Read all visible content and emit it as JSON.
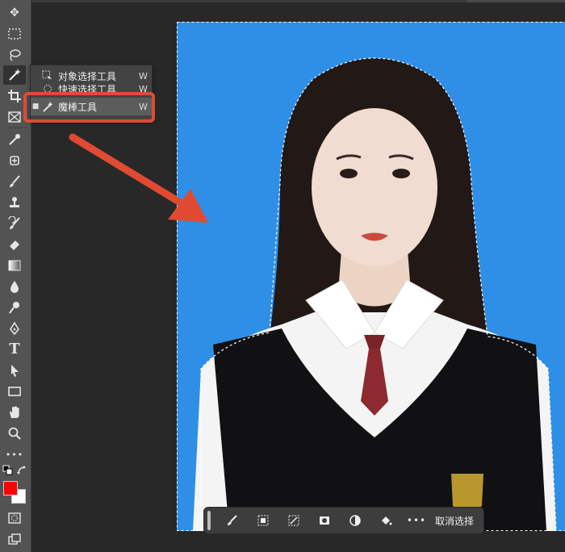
{
  "toolbar": {
    "tools": [
      {
        "name": "move-tool-icon",
        "glyph": "✥"
      },
      {
        "name": "marquee-tool-icon",
        "glyph": "⬚"
      },
      {
        "name": "lasso-tool-icon",
        "glyph": "ℓ"
      },
      {
        "name": "magic-wand-tool-icon",
        "glyph": "✶"
      },
      {
        "name": "crop-tool-icon",
        "glyph": "⌗"
      },
      {
        "name": "frame-tool-icon",
        "glyph": "⊠"
      },
      {
        "name": "eyedropper-tool-icon",
        "glyph": "⟋"
      },
      {
        "name": "healing-brush-tool-icon",
        "glyph": "✚"
      },
      {
        "name": "brush-tool-icon",
        "glyph": "✎"
      },
      {
        "name": "clone-stamp-tool-icon",
        "glyph": "⊥"
      },
      {
        "name": "history-brush-tool-icon",
        "glyph": "↺"
      },
      {
        "name": "eraser-tool-icon",
        "glyph": "◇"
      },
      {
        "name": "gradient-tool-icon",
        "glyph": "▦"
      },
      {
        "name": "blur-tool-icon",
        "glyph": "💧"
      },
      {
        "name": "dodge-tool-icon",
        "glyph": "⚲"
      },
      {
        "name": "pen-tool-icon",
        "glyph": "✒"
      },
      {
        "name": "type-tool-icon",
        "glyph": "T"
      },
      {
        "name": "path-selection-tool-icon",
        "glyph": "➤"
      },
      {
        "name": "rectangle-tool-icon",
        "glyph": "▭"
      },
      {
        "name": "hand-tool-icon",
        "glyph": "✋"
      },
      {
        "name": "zoom-tool-icon",
        "glyph": "⚲"
      },
      {
        "name": "more-tools-icon",
        "glyph": "•••"
      }
    ],
    "foreground_color": "#ff0000",
    "background_color": "#ffffff"
  },
  "flyout": {
    "items": [
      {
        "label": "对象选择工具",
        "shortcut": "W"
      },
      {
        "label": "快速选择工具",
        "shortcut": "W"
      },
      {
        "label": "魔棒工具",
        "shortcut": "W",
        "selected": true
      }
    ]
  },
  "context_bar": {
    "deselect_label": "取消选择"
  },
  "colors": {
    "accent_highlight": "#e04a33",
    "photo_background": "#2f8fe6"
  }
}
